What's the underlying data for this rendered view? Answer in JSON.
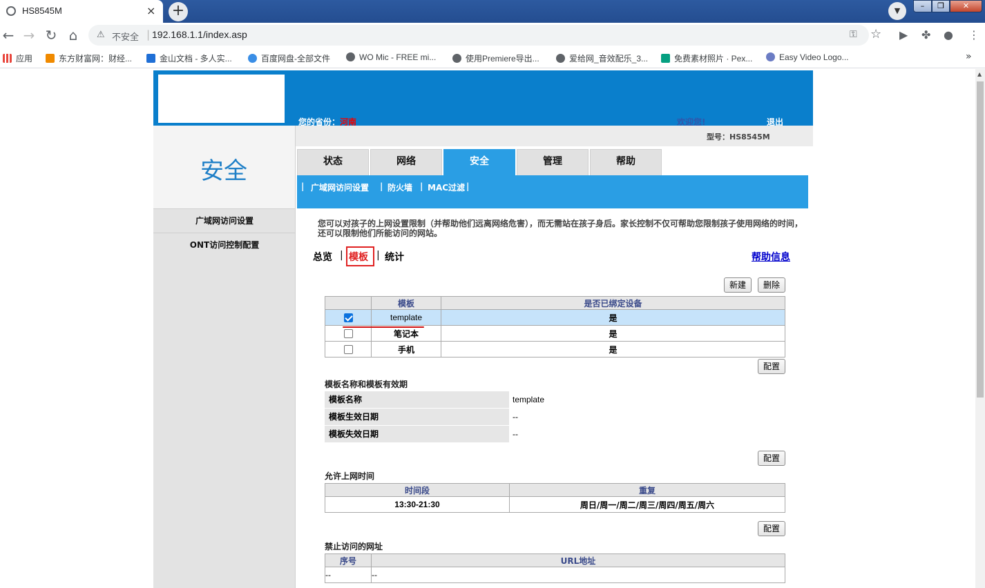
{
  "browser": {
    "tab_title": "HS8545M",
    "tab_close": "×",
    "new_tab": "+",
    "insecure_label": "不安全",
    "url": "192.168.1.1/index.asp",
    "bookmarks": [
      {
        "label": "应用",
        "color": "#4285f4"
      },
      {
        "label": "东方财富网：财经...",
        "color": "#f08a00"
      },
      {
        "label": "金山文档 - 多人实...",
        "color": "#1f6fd6"
      },
      {
        "label": "百度网盘-全部文件",
        "color": "#3a8ee6"
      },
      {
        "label": "WO Mic - FREE mi...",
        "color": "#5f6368"
      },
      {
        "label": "使用Premiere导出...",
        "color": "#5f6368"
      },
      {
        "label": "爱给网_音效配乐_3...",
        "color": "#5f6368"
      },
      {
        "label": "免费素材照片 · Pex...",
        "color": "#05a081"
      },
      {
        "label": "Easy Video Logo...",
        "color": "#6b7cc4"
      }
    ]
  },
  "header": {
    "province_label": "您的省份：",
    "province_value": "河南",
    "welcome": "欢迎您!",
    "logout": "退出",
    "model": "型号：HS8545M"
  },
  "sidebar": {
    "title": "安全",
    "items": [
      "广域网访问设置",
      "ONT访问控制配置"
    ]
  },
  "main_tabs": [
    "状态",
    "网络",
    "安全",
    "管理",
    "帮助"
  ],
  "active_tab": "安全",
  "subnav": [
    "广域网访问设置",
    "防火墙",
    "MAC过滤"
  ],
  "description": "您可以对孩子的上网设置限制（并帮助他们远离网络危害），而无需站在孩子身后。家长控制不仅可帮助您限制孩子使用网络的时间，还可以限制他们所能访问的网站。",
  "view_nav": {
    "overview": "总览",
    "template": "模板",
    "stats": "统计",
    "help": "帮助信息"
  },
  "buttons": {
    "new": "新建",
    "delete": "删除",
    "config": "配置"
  },
  "template_table": {
    "headers": [
      "模板",
      "是否已绑定设备"
    ],
    "rows": [
      {
        "checked": true,
        "name": "template",
        "bound": "是"
      },
      {
        "checked": false,
        "name": "笔记本",
        "bound": "是"
      },
      {
        "checked": false,
        "name": "手机",
        "bound": "是"
      }
    ]
  },
  "template_info": {
    "section_title": "模板名称和模板有效期",
    "rows": [
      {
        "label": "模板名称",
        "value": "template"
      },
      {
        "label": "模板生效日期",
        "value": "--"
      },
      {
        "label": "模板失效日期",
        "value": "--"
      }
    ]
  },
  "time_table": {
    "section_title": "允许上网时间",
    "headers": [
      "时间段",
      "重复"
    ],
    "rows": [
      {
        "period": "13:30-21:30",
        "repeat": "周日/周一/周二/周三/周四/周五/周六"
      }
    ]
  },
  "url_table": {
    "section_title": "禁止访问的网址",
    "headers": [
      "序号",
      "URL地址"
    ],
    "rows": [
      {
        "index": "--",
        "url": "--"
      }
    ]
  }
}
